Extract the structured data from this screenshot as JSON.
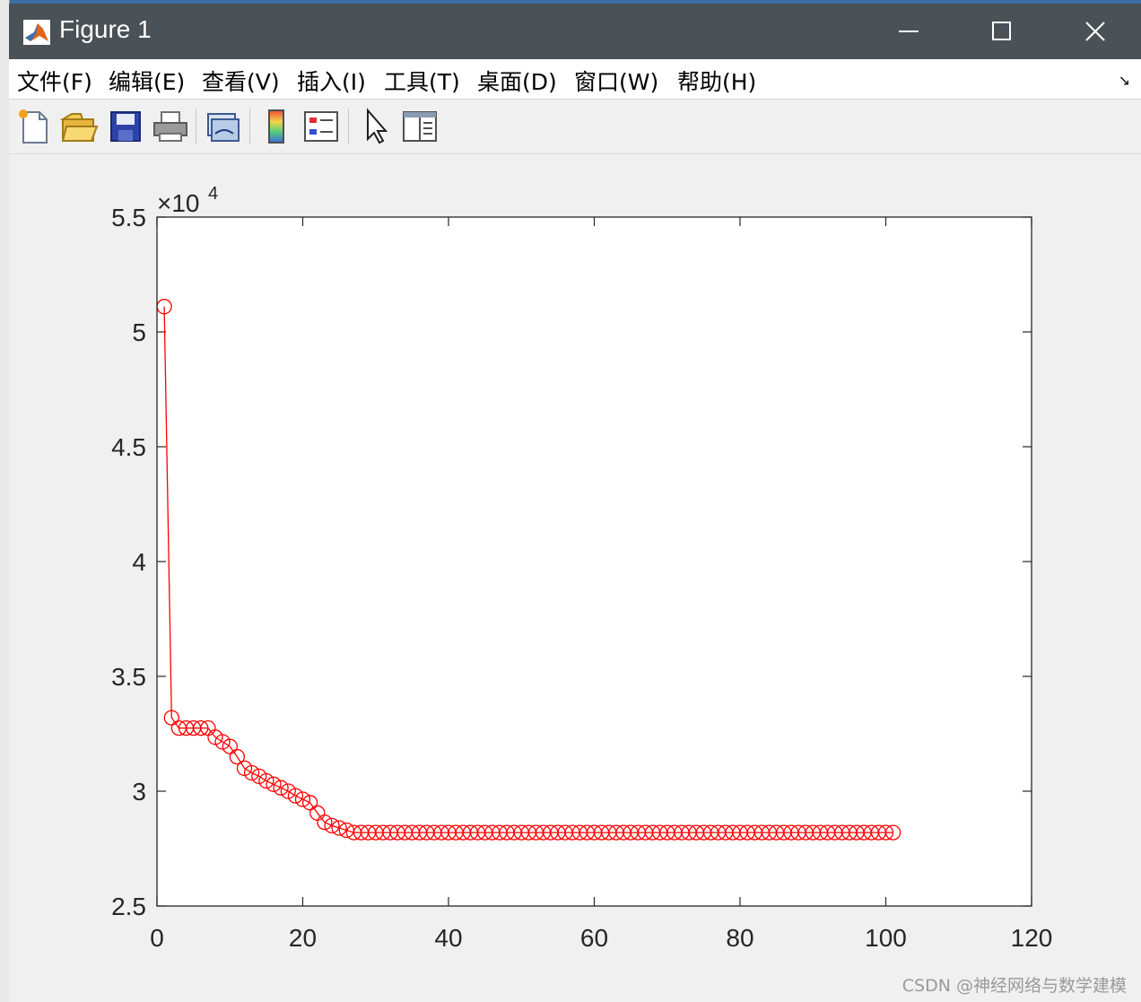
{
  "window": {
    "title": "Figure 1",
    "menu": [
      {
        "label": "文件(F)"
      },
      {
        "label": "编辑(E)"
      },
      {
        "label": "查看(V)"
      },
      {
        "label": "插入(I)"
      },
      {
        "label": "工具(T)"
      },
      {
        "label": "桌面(D)"
      },
      {
        "label": "窗口(W)"
      },
      {
        "label": "帮助(H)"
      }
    ],
    "toolbar_icons": [
      "new-figure-icon",
      "open-file-icon",
      "save-icon",
      "print-icon",
      "link-plot-icon",
      "colorbar-icon",
      "legend-icon",
      "edit-plot-arrow-icon",
      "property-inspector-icon"
    ]
  },
  "chart_data": {
    "type": "line",
    "title": "",
    "xlabel": "",
    "ylabel": "",
    "xlim": [
      0,
      120
    ],
    "ylim": [
      25000,
      55000
    ],
    "x_ticks": [
      "0",
      "20",
      "40",
      "60",
      "80",
      "100",
      "120"
    ],
    "y_ticks": [
      "2.5",
      "3",
      "3.5",
      "4",
      "4.5",
      "5",
      "5.5"
    ],
    "y_exponent_base": "×10",
    "y_exponent_power": "4",
    "grid": false,
    "legend": "none",
    "series": [
      {
        "color": "#ff0000",
        "marker": "circle",
        "x": [
          1,
          2,
          3,
          4,
          5,
          6,
          7,
          8,
          9,
          10,
          11,
          12,
          13,
          14,
          15,
          16,
          17,
          18,
          19,
          20,
          21,
          22,
          23,
          24,
          25,
          26,
          27,
          28,
          29,
          30,
          31,
          32,
          33,
          34,
          35,
          36,
          37,
          38,
          39,
          40,
          41,
          42,
          43,
          44,
          45,
          46,
          47,
          48,
          49,
          50,
          51,
          52,
          53,
          54,
          55,
          56,
          57,
          58,
          59,
          60,
          61,
          62,
          63,
          64,
          65,
          66,
          67,
          68,
          69,
          70,
          71,
          72,
          73,
          74,
          75,
          76,
          77,
          78,
          79,
          80,
          81,
          82,
          83,
          84,
          85,
          86,
          87,
          88,
          89,
          90,
          91,
          92,
          93,
          94,
          95,
          96,
          97,
          98,
          99,
          100,
          101
        ],
        "y": [
          51100,
          33200,
          32750,
          32750,
          32750,
          32750,
          32750,
          32350,
          32150,
          31950,
          31500,
          31000,
          30800,
          30650,
          30450,
          30300,
          30150,
          30000,
          29800,
          29650,
          29500,
          29050,
          28650,
          28500,
          28400,
          28300,
          28200,
          28200,
          28200,
          28200,
          28200,
          28200,
          28200,
          28200,
          28200,
          28200,
          28200,
          28200,
          28200,
          28200,
          28200,
          28200,
          28200,
          28200,
          28200,
          28200,
          28200,
          28200,
          28200,
          28200,
          28200,
          28200,
          28200,
          28200,
          28200,
          28200,
          28200,
          28200,
          28200,
          28200,
          28200,
          28200,
          28200,
          28200,
          28200,
          28200,
          28200,
          28200,
          28200,
          28200,
          28200,
          28200,
          28200,
          28200,
          28200,
          28200,
          28200,
          28200,
          28200,
          28200,
          28200,
          28200,
          28200,
          28200,
          28200,
          28200,
          28200,
          28200,
          28200,
          28200,
          28200,
          28200,
          28200,
          28200,
          28200,
          28200,
          28200,
          28200,
          28200,
          28200,
          28200
        ]
      }
    ]
  },
  "watermark": "CSDN @神经网络与数学建模"
}
